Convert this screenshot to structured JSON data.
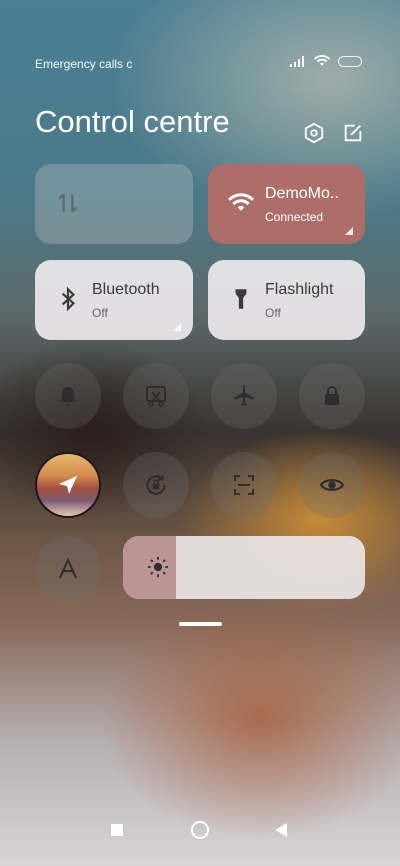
{
  "status_bar": {
    "carrier_text": "Emergency calls c"
  },
  "header": {
    "title": "Control centre"
  },
  "tiles": {
    "mobile_data": {
      "label": "",
      "sub": ""
    },
    "wifi": {
      "label": "DemoMo..",
      "sub": "Connected"
    },
    "bluetooth": {
      "label": "Bluetooth",
      "sub": "Off"
    },
    "flashlight": {
      "label": "Flashlight",
      "sub": "Off"
    }
  },
  "brightness": {
    "level": 0.22
  },
  "colors": {
    "wifi_tile": "#ad6e6a",
    "brightness_fill": "#bb9593"
  }
}
